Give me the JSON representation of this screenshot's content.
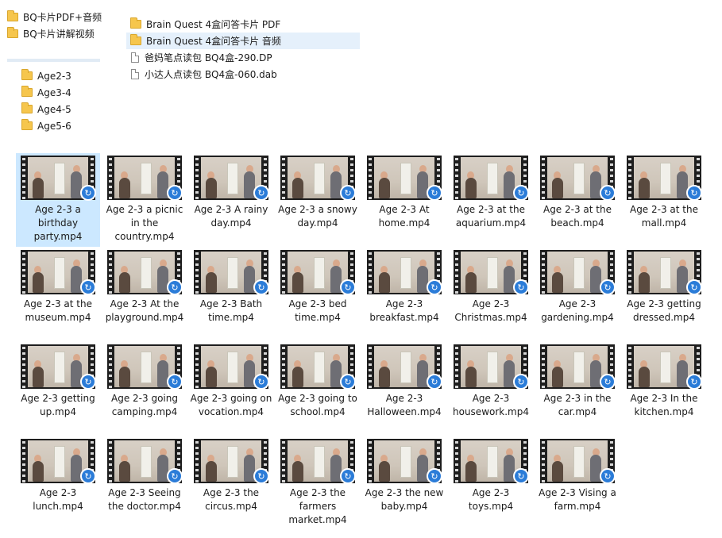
{
  "nav_tree": {
    "top_items": [
      {
        "label": "BQ卡片PDF+音频",
        "icon": "folder-icon"
      },
      {
        "label": "BQ卡片讲解视频",
        "icon": "folder-icon"
      }
    ],
    "age_items": [
      {
        "label": "Age2-3",
        "icon": "folder-icon"
      },
      {
        "label": "Age3-4",
        "icon": "folder-icon"
      },
      {
        "label": "Age4-5",
        "icon": "folder-icon"
      },
      {
        "label": "Age5-6",
        "icon": "folder-icon"
      }
    ]
  },
  "file_list": [
    {
      "label": "Brain Quest 4盒问答卡片 PDF",
      "icon": "folder-icon",
      "selected": false
    },
    {
      "label": "Brain Quest 4盒问答卡片 音频",
      "icon": "folder-icon",
      "selected": true
    },
    {
      "label": "爸妈笔点读包  BQ4盒-290.DP",
      "icon": "file-icon",
      "selected": false
    },
    {
      "label": "小达人点读包  BQ4盒-060.dab",
      "icon": "file-icon",
      "selected": false
    }
  ],
  "videos": [
    {
      "name": "Age 2-3 a birthday party.mp4",
      "selected": true
    },
    {
      "name": "Age 2-3 a picnic in the country.mp4"
    },
    {
      "name": "Age 2-3 A rainy day.mp4"
    },
    {
      "name": "Age 2-3 a snowy day.mp4"
    },
    {
      "name": "Age 2-3 At home.mp4"
    },
    {
      "name": "Age 2-3 at the aquarium.mp4"
    },
    {
      "name": "Age 2-3 at the beach.mp4"
    },
    {
      "name": "Age 2-3 at the mall.mp4"
    },
    {
      "name": "Age 2-3 at the museum.mp4"
    },
    {
      "name": "Age 2-3 At the playground.mp4"
    },
    {
      "name": "Age 2-3 Bath time.mp4"
    },
    {
      "name": "Age 2-3 bed time.mp4"
    },
    {
      "name": "Age 2-3 breakfast.mp4"
    },
    {
      "name": "Age 2-3 Christmas.mp4"
    },
    {
      "name": "Age 2-3 gardening.mp4"
    },
    {
      "name": "Age 2-3 getting dressed.mp4"
    },
    {
      "name": "Age 2-3 getting up.mp4"
    },
    {
      "name": "Age 2-3 going camping.mp4"
    },
    {
      "name": "Age 2-3 going on vocation.mp4"
    },
    {
      "name": "Age 2-3 going to school.mp4"
    },
    {
      "name": "Age 2-3 Halloween.mp4"
    },
    {
      "name": "Age 2-3 housework.mp4"
    },
    {
      "name": "Age 2-3 in the car.mp4"
    },
    {
      "name": "Age 2-3 In the kitchen.mp4"
    },
    {
      "name": "Age 2-3 lunch.mp4"
    },
    {
      "name": "Age 2-3 Seeing the doctor.mp4"
    },
    {
      "name": "Age 2-3 the circus.mp4"
    },
    {
      "name": "Age 2-3 the farmers market.mp4"
    },
    {
      "name": "Age 2-3 the new baby.mp4"
    },
    {
      "name": "Age 2-3 toys.mp4"
    },
    {
      "name": "Age 2-3 Vising a farm.mp4"
    }
  ],
  "icons": {
    "folder": "folder-icon",
    "file": "file-icon",
    "video_thumbnail": "video-thumbnail-icon",
    "player_badge": "player-badge-icon",
    "badge_glyph": "↻"
  },
  "colors": {
    "selection": "#cce8ff",
    "row_selection": "#e5f0fb",
    "folder": "#f6c64d",
    "badge": "#2b7cd8"
  }
}
